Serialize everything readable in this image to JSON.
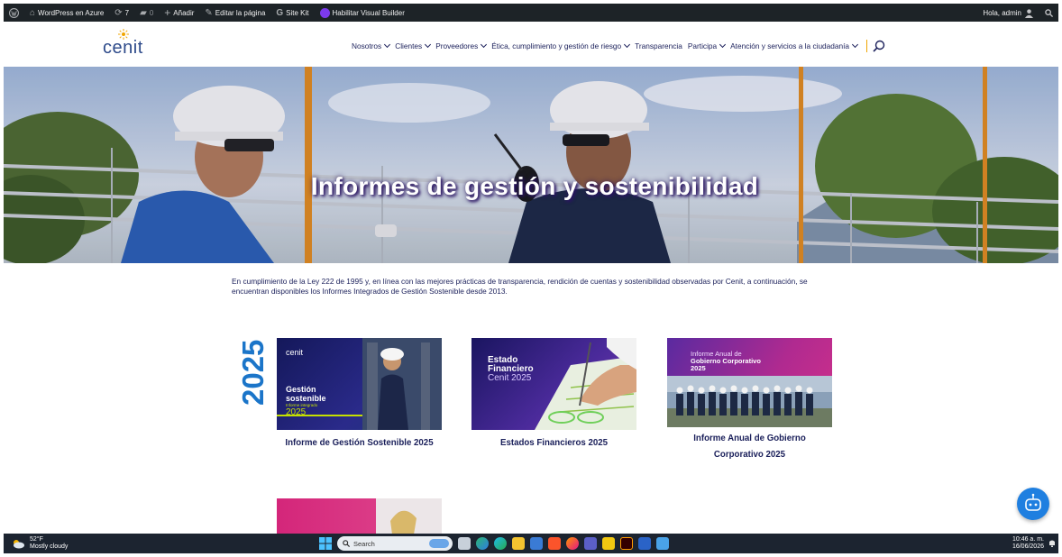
{
  "adminbar": {
    "site_name": "WordPress en Azure",
    "updates_count": "7",
    "comments_count": "0",
    "new_label": "Añadir",
    "edit_label": "Editar la página",
    "sitekit_label": "Site Kit",
    "visual_builder_label": "Habilitar Visual Builder",
    "greeting": "Hola, admin"
  },
  "header": {
    "logo_text": "cenit",
    "nav": [
      {
        "label": "Nosotros",
        "dropdown": true
      },
      {
        "label": "Clientes",
        "dropdown": true
      },
      {
        "label": "Proveedores",
        "dropdown": true
      },
      {
        "label": "Ética, cumplimiento y gestión de riesgo",
        "dropdown": true
      },
      {
        "label": "Transparencia",
        "dropdown": false
      },
      {
        "label": "Participa",
        "dropdown": true
      },
      {
        "label": "Atención y servicios a la ciudadanía",
        "dropdown": true
      }
    ]
  },
  "hero": {
    "title": "Informes de gestión y sostenibilidad"
  },
  "intro": "En cumplimiento de la Ley 222 de 1995 y, en línea con las mejores prácticas de transparencia, rendición de cuentas y sostenibilidad observadas por Cenit, a continuación, se encuentran disponibles los Informes Integrados de Gestión Sostenible desde 2013.",
  "year_label": "2025",
  "cards": [
    {
      "title": "Informe de Gestión Sostenible 2025",
      "thumb": {
        "logo": "cenit",
        "line1": "Gestión",
        "line2": "sostenible",
        "line3": "Informe integrado",
        "year": "2025"
      }
    },
    {
      "title": "Estados Financieros 2025",
      "thumb": {
        "line1": "Estado",
        "line2": "Financiero",
        "line3": "Cenit 2025"
      }
    },
    {
      "title": "Informe Anual de Gobierno Corporativo 2025",
      "thumb": {
        "line1": "Informe Anual de",
        "line2": "Gobierno Corporativo",
        "line3": "2025"
      }
    }
  ],
  "taskbar": {
    "temperature": "52°F",
    "weather": "Mostly cloudy",
    "search_placeholder": "Search",
    "time": "10:46 a. m.",
    "date": "16/06/2026"
  },
  "colors": {
    "navy": "#1a1f5a",
    "accent_orange": "#f0a500",
    "chat_blue": "#1f7fe0",
    "year_blue": "#1b75c9"
  }
}
